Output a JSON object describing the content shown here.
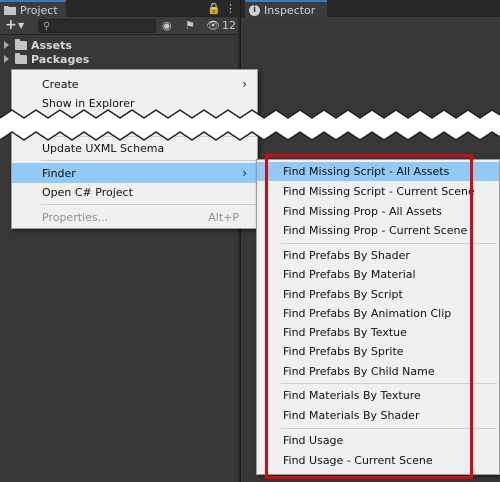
{
  "project_panel": {
    "tab_title": "Project",
    "hidden_count": "12",
    "tree": [
      "Assets",
      "Packages"
    ]
  },
  "inspector_panel": {
    "tab_title": "Inspector"
  },
  "context_menu": {
    "items": [
      {
        "label": "Create",
        "submenu": true
      },
      {
        "label": "Show in Explorer"
      },
      {
        "label": "Update UXML Schema"
      },
      {
        "label": "Finder",
        "submenu": true,
        "highlighted": true
      },
      {
        "label": "Open C# Project"
      },
      {
        "label": "Properties...",
        "shortcut": "Alt+P",
        "disabled": true
      }
    ]
  },
  "finder_submenu": {
    "items": [
      "Find Missing Script - All Assets",
      "Find Missing Script - Current Scene",
      "Find Missing Prop - All Assets",
      "Find Missing Prop - Current Scene",
      "Find Prefabs By Shader",
      "Find Prefabs By Material",
      "Find Prefabs By Script",
      "Find Prefabs By Animation Clip",
      "Find Prefabs By Textue",
      "Find Prefabs By Sprite",
      "Find Prefabs By Child Name",
      "Find Materials By Texture",
      "Find Materials By Shader",
      "Find Usage",
      "Find Usage - Current Scene"
    ]
  },
  "colors": {
    "highlight": "#91c9f7",
    "annotation_box": "#d60a0a",
    "panel_bg": "#383838",
    "menu_bg": "#f0f0f0"
  }
}
